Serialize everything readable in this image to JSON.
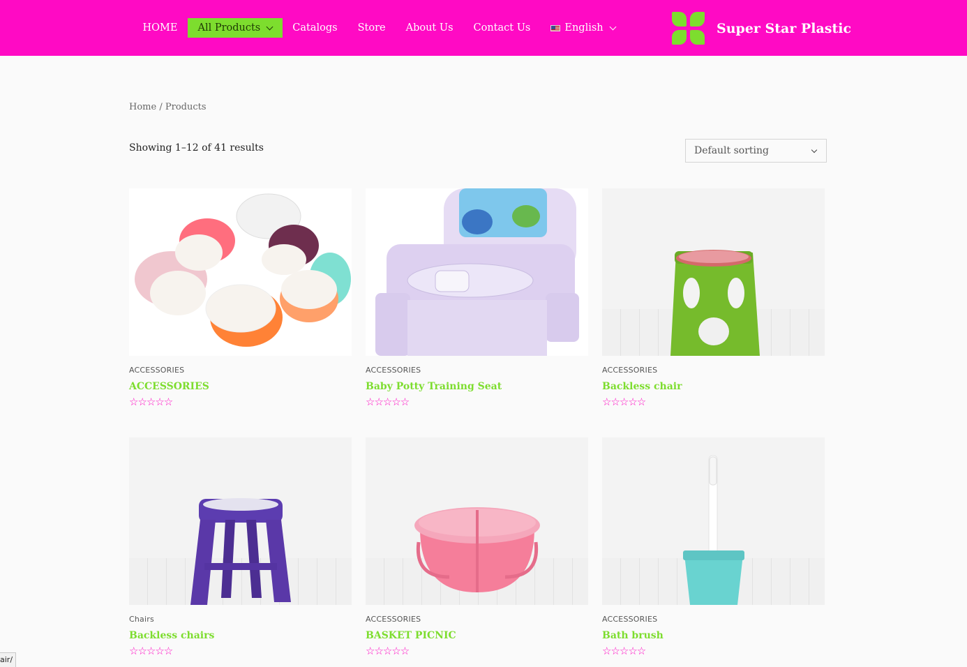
{
  "nav": {
    "items": [
      {
        "label": "HOME"
      },
      {
        "label": "All Products",
        "active": true,
        "has_dropdown": true
      },
      {
        "label": "Catalogs"
      },
      {
        "label": "Store"
      },
      {
        "label": "About Us"
      },
      {
        "label": "Contact Us"
      },
      {
        "label": "English",
        "icon": "us-flag-icon",
        "has_dropdown": true
      }
    ]
  },
  "brand": {
    "name": "Super Star Plastic",
    "logo": "four-leaf-logo"
  },
  "breadcrumb": {
    "home": "Home",
    "separator": "/",
    "current": "Products"
  },
  "results": {
    "text": "Showing 1–12 of 41 results"
  },
  "sort": {
    "selected": "Default sorting"
  },
  "products": [
    {
      "category": "ACCESSORIES",
      "title": "ACCESSORIES",
      "rating": 0,
      "stars": "☆☆☆☆☆"
    },
    {
      "category": "ACCESSORIES",
      "title": "Baby Potty Training Seat",
      "rating": 0,
      "stars": "☆☆☆☆☆"
    },
    {
      "category": "ACCESSORIES",
      "title": "Backless chair",
      "rating": 0,
      "stars": "☆☆☆☆☆"
    },
    {
      "category": "Chairs",
      "title": "Backless chairs",
      "rating": 0,
      "stars": "☆☆☆☆☆"
    },
    {
      "category": "ACCESSORIES",
      "title": "BASKET PICNIC",
      "rating": 0,
      "stars": "☆☆☆☆☆"
    },
    {
      "category": "ACCESSORIES",
      "title": "Bath brush",
      "rating": 0,
      "stars": "☆☆☆☆☆"
    }
  ],
  "status_bar": {
    "url": "air/"
  },
  "colors": {
    "header": "#ff0ac4",
    "accent": "#7ddd2e",
    "star": "#ff0ac4"
  }
}
